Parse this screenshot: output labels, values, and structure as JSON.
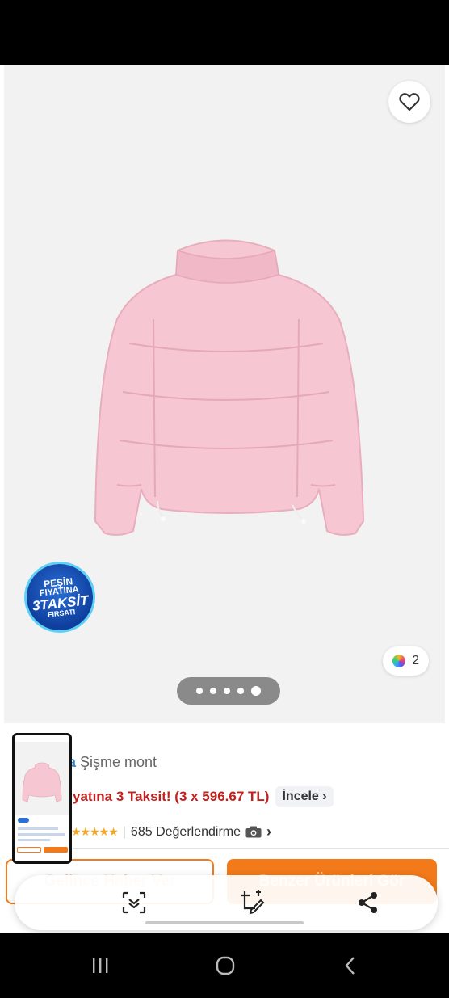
{
  "product": {
    "title_fragment": "a",
    "title": "Şişme mont",
    "promo_text": "yatına 3 Taksit! (3 x 596.67 TL)",
    "incele_label": "İncele",
    "rating_count_label": "685 Değerlendirme",
    "rating": 4.5
  },
  "gallery": {
    "image_count": 5,
    "active_index": 4,
    "color_count": "2",
    "product_color": "#f6c6d2"
  },
  "badge": {
    "line1": "PEŞİN",
    "line2": "FIYATINA",
    "line3": "3TAKSİT",
    "line4": "FIRSATI"
  },
  "buttons": {
    "notify_label": "Gelince Haber Ver",
    "similar_label": "Benzer Ürünleri Gör"
  },
  "colors": {
    "accent": "#f27a1a",
    "promo_red": "#c0201e",
    "brand_blue": "#2f86c9"
  },
  "toolbar": {
    "icons": [
      "scan-text-icon",
      "crop-edit-icon",
      "share-icon"
    ]
  },
  "nav": {
    "icons": [
      "recent-apps-icon",
      "home-icon",
      "back-icon"
    ]
  }
}
